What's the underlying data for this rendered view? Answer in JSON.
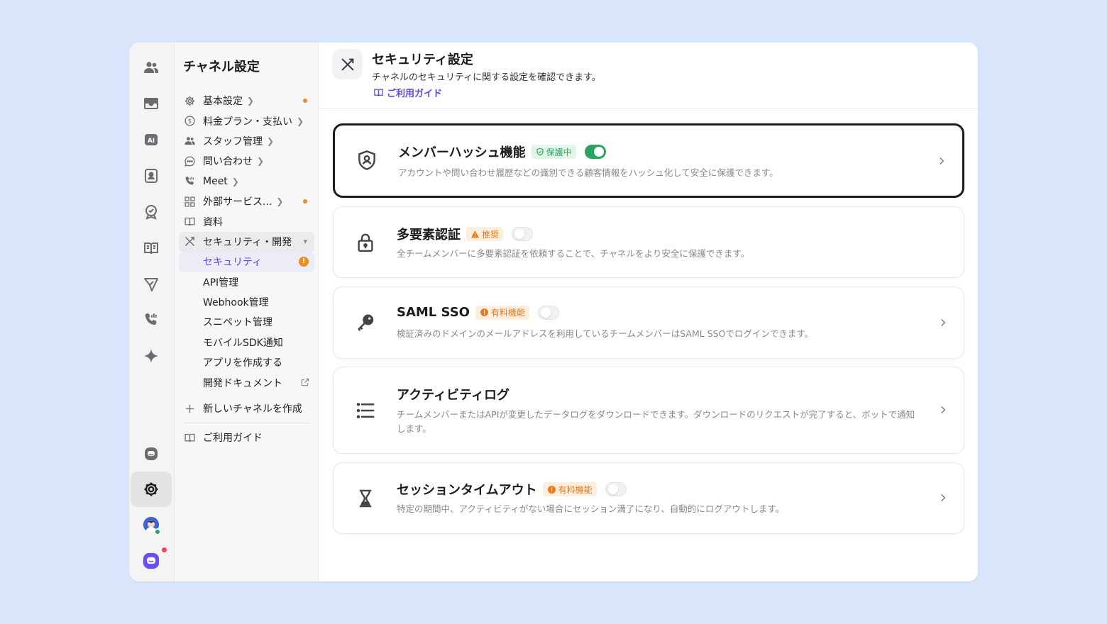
{
  "sidebar": {
    "title": "チャネル設定",
    "items": [
      {
        "label": "基本設定",
        "icon": "gear-icon",
        "dot": true
      },
      {
        "label": "料金プラン・支払い",
        "icon": "dollar-icon",
        "dot": false
      },
      {
        "label": "スタッフ管理",
        "icon": "people-icon",
        "dot": false
      },
      {
        "label": "問い合わせ",
        "icon": "chat-icon",
        "dot": false
      },
      {
        "label": "Meet",
        "icon": "phone-icon",
        "dot": false
      },
      {
        "label": "外部サービス...",
        "icon": "grid-icon",
        "dot": true
      },
      {
        "label": "資料",
        "icon": "book-icon",
        "dot": false
      },
      {
        "label": "セキュリティ・開発",
        "icon": "tools-icon",
        "dot": false
      }
    ],
    "sub_items": [
      {
        "label": "セキュリティ"
      },
      {
        "label": "API管理"
      },
      {
        "label": "Webhook管理"
      },
      {
        "label": "スニペット管理"
      },
      {
        "label": "モバイルSDK通知"
      },
      {
        "label": "アプリを作成する"
      },
      {
        "label": "開発ドキュメント"
      }
    ],
    "warning_mark": "!",
    "new_channel": "新しいチャネルを作成",
    "guide": "ご利用ガイド"
  },
  "header": {
    "title": "セキュリティ設定",
    "subtitle": "チャネルのセキュリティに関する設定を確認できます。",
    "guide_link": "ご利用ガイド"
  },
  "cards": [
    {
      "title": "メンバーハッシュ機能",
      "badge": "保護中",
      "badge_color": "#2aa65c",
      "toggle_on": true,
      "desc": "アカウントや問い合わせ履歴などの識別できる顧客情報をハッシュ化して安全に保護できます。",
      "icon": "shield-user-icon"
    },
    {
      "title": "多要素認証",
      "badge": "推奨",
      "badge_color": "#e9791a",
      "toggle_on": false,
      "desc": "全チームメンバーに多要素認証を依頼することで、チャネルをより安全に保護できます。",
      "icon": "lock-icon"
    },
    {
      "title": "SAML SSO",
      "badge": "有料機能",
      "badge_color": "#e9791a",
      "toggle_on": false,
      "desc": "検証済みのドメインのメールアドレスを利用しているチームメンバーはSAML SSOでログインできます。",
      "icon": "key-icon"
    },
    {
      "title": "アクティビティログ",
      "badge": "",
      "toggle_on": null,
      "desc": "チームメンバーまたはAPIが変更したデータログをダウンロードできます。ダウンロードのリクエストが完了すると、ボットで通知します。",
      "icon": "list-icon"
    },
    {
      "title": "セッションタイムアウト",
      "badge": "有料機能",
      "badge_color": "#e9791a",
      "toggle_on": false,
      "desc": "特定の期間中、アクティビティがない場合にセッション満了になり、自動的にログアウトします。",
      "icon": "hourglass-icon"
    }
  ],
  "colors": {
    "accent": "#5a46e8",
    "green": "#2aa65c",
    "orange": "#f08c1e"
  }
}
